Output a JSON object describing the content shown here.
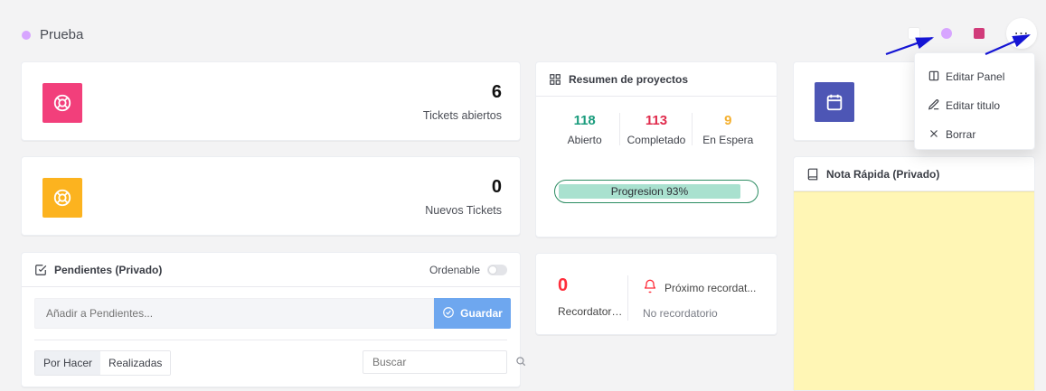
{
  "dashboard": {
    "title": "Prueba",
    "title_dot_color": "#d7a5ff"
  },
  "top_actions": {
    "square_color": "#ffffff",
    "dot_color": "#d7a5ff",
    "rect_color": "#d13b7a",
    "more_glyph": "⋯"
  },
  "stats": [
    {
      "value": "6",
      "label": "Tickets abiertos",
      "icon": "lifebuoy-icon",
      "tile_color": "#f23f7b"
    },
    {
      "value": "0",
      "label": "Nuevos Tickets",
      "icon": "lifebuoy-icon",
      "tile_color": "#fcb31f"
    }
  ],
  "projects": {
    "title": "Resumen de proyectos",
    "icon": "grid-icon",
    "metrics": [
      {
        "value": "118",
        "label": "Abierto",
        "color": "#1a9c7d"
      },
      {
        "value": "113",
        "label": "Completado",
        "color": "#e02b4c"
      },
      {
        "value": "9",
        "label": "En Espera",
        "color": "#f4b02f"
      }
    ],
    "progress": {
      "label": "Progresion 93%",
      "percent": 93,
      "border_color": "#2c8c62",
      "fill_color": "#a9e1cf"
    }
  },
  "reminders": {
    "count": "0",
    "label": "Recordatori...",
    "next_title": "Próximo recordat...",
    "next_subtitle": "No recordatorio",
    "bell_color": "#ff2e3b",
    "count_color": "#ff2e3b"
  },
  "pending": {
    "title": "Pendientes (Privado)",
    "sortable_label": "Ordenable",
    "input_placeholder": "Añadir a Pendientes...",
    "save_label": "Guardar",
    "save_icon": "check-circle-icon",
    "tabs": [
      {
        "label": "Por Hacer",
        "active": true
      },
      {
        "label": "Realizadas",
        "active": false
      }
    ],
    "search_placeholder": "Buscar",
    "search_icon": "search-icon"
  },
  "calendar": {
    "icon": "calendar-icon",
    "tile_color": "#4d56b5"
  },
  "note": {
    "title": "Nota Rápida (Privado)",
    "icon": "book-icon",
    "note_color": "#fff6b5"
  },
  "dropdown": {
    "items": [
      {
        "label": "Editar Panel",
        "icon": "panel-icon"
      },
      {
        "label": "Editar titulo",
        "icon": "edit-icon"
      },
      {
        "label": "Borrar",
        "icon": "close-icon"
      }
    ]
  }
}
